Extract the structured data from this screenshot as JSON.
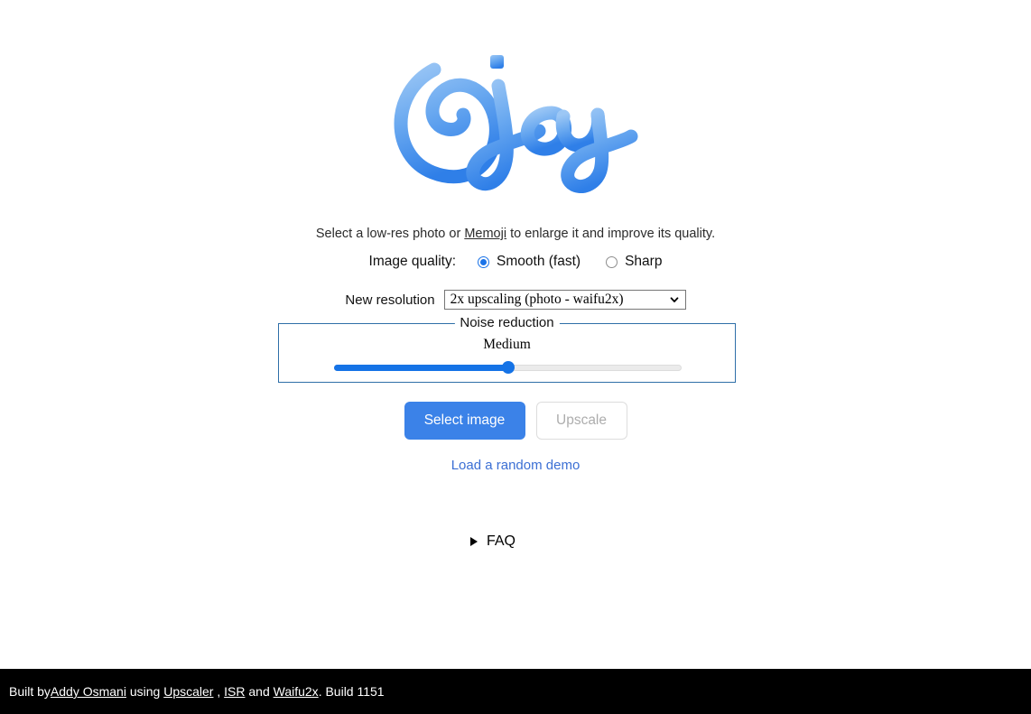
{
  "app": {
    "logo_text": "Ojoy",
    "logo_color_top": "#8cbdf2",
    "logo_color_bottom": "#3080e8",
    "accent_color": "#3b82e8"
  },
  "tagline": {
    "before": "Select a low-res photo or ",
    "link": "Memoji",
    "after": " to enlarge it and improve its quality."
  },
  "quality": {
    "label": "Image quality:",
    "options": [
      {
        "label": "Smooth (fast)",
        "checked": true
      },
      {
        "label": "Sharp",
        "checked": false
      }
    ]
  },
  "resolution": {
    "label": "New resolution",
    "selected": "2x upscaling (photo - waifu2x)",
    "icon": "chevron-down-icon"
  },
  "noise": {
    "legend": "Noise reduction",
    "value_label": "Medium",
    "percent": 50
  },
  "actions": {
    "select_image": "Select image",
    "upscale": "Upscale",
    "upscale_disabled": true,
    "demo_link": "Load a random demo"
  },
  "faq": {
    "label": "FAQ",
    "expanded": false,
    "marker": "disclosure-triangle-icon"
  },
  "footer": {
    "built_by": "Built by ",
    "author": "Addy Osmani",
    "using": " using ",
    "lib1": "Upscaler",
    "sep1": " , ",
    "lib2": "ISR",
    "sep2": " and ",
    "lib3": "Waifu2x",
    "build": ". Build 1151"
  }
}
